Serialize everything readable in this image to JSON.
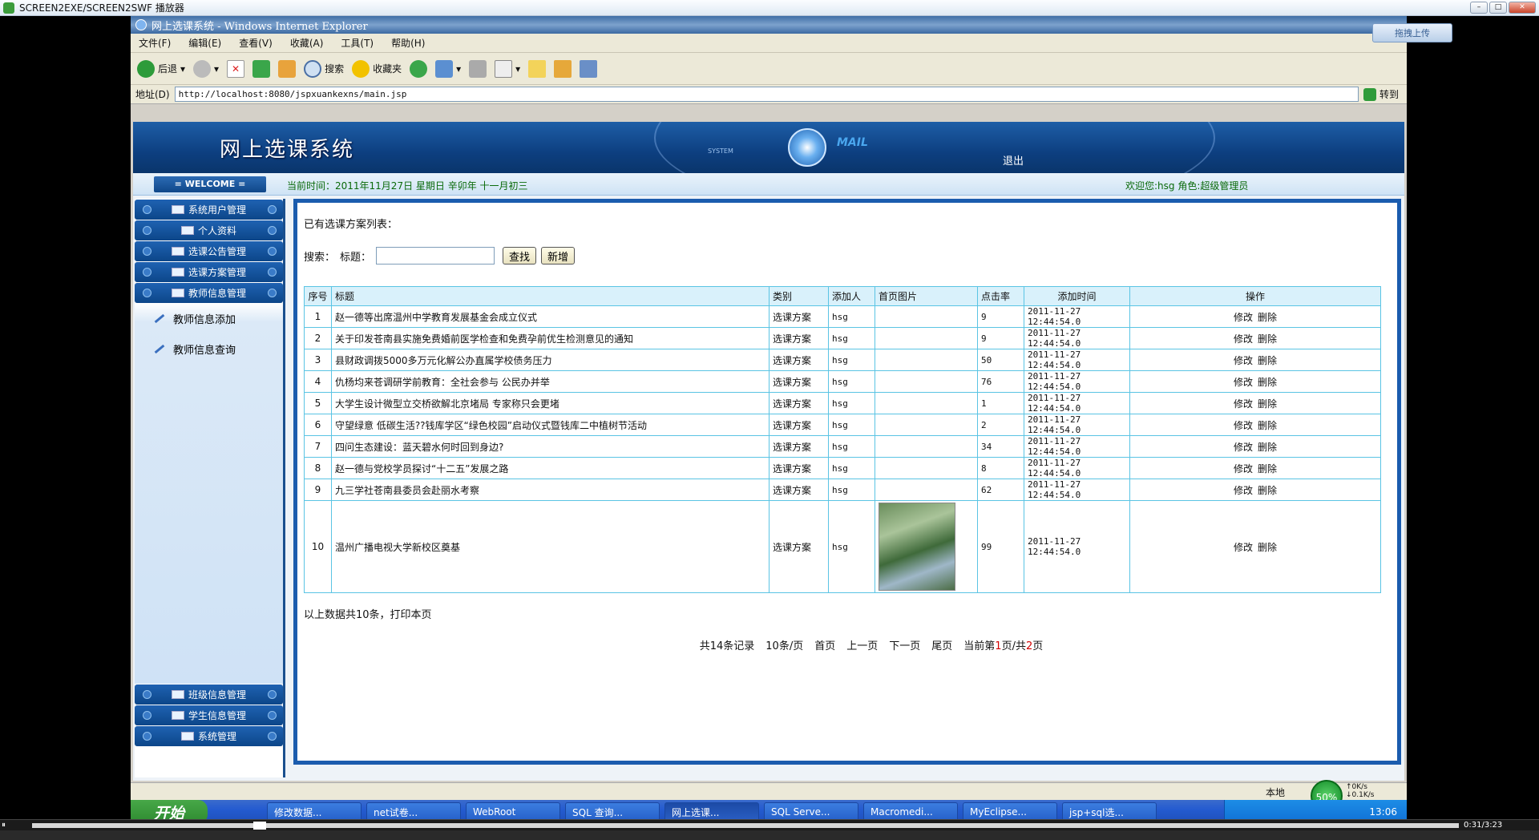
{
  "player": {
    "title": "SCREEN2EXE/SCREEN2SWF 播放器",
    "time": "0:31/3:23"
  },
  "browser": {
    "title": "网上选课系统 - Windows Internet Explorer",
    "upload_label": "拖拽上传",
    "menu": [
      "文件(F)",
      "编辑(E)",
      "查看(V)",
      "收藏(A)",
      "工具(T)",
      "帮助(H)"
    ],
    "toolbar": {
      "back": "后退",
      "search": "搜索",
      "favorites": "收藏夹"
    },
    "address_label": "地址(D)",
    "url": "http://localhost:8080/jspxuankexns/main.jsp",
    "go": "转到"
  },
  "header": {
    "title": "网上选课系统",
    "system_text": "SYSTEM",
    "mail_text": "MAIL",
    "logout": "退出",
    "welcome": "= WELCOME =",
    "current_time": "当前时间：2011年11月27日 星期日 辛卯年 十一月初三",
    "user_info": "欢迎您:hsg 角色:超级管理员"
  },
  "sidebar": {
    "items": [
      "系统用户管理",
      "个人资料",
      "选课公告管理",
      "选课方案管理",
      "教师信息管理"
    ],
    "subitems": [
      "教师信息添加",
      "教师信息查询"
    ],
    "lower_items": [
      "班级信息管理",
      "学生信息管理",
      "系统管理"
    ]
  },
  "main": {
    "list_title": "已有选课方案列表：",
    "search_label": "搜索：",
    "title_label": "标题：",
    "search_btn": "查找",
    "add_btn": "新增",
    "columns": [
      "序号",
      "标题",
      "类别",
      "添加人",
      "首页图片",
      "点击率",
      "添加时间",
      "操作"
    ],
    "rows": [
      {
        "no": "1",
        "title": "赵一德等出席温州中学教育发展基金会成立仪式",
        "category": "选课方案",
        "adder": "hsg",
        "clicks": "9",
        "time": "2011-11-27 12:44:54.0"
      },
      {
        "no": "2",
        "title": "关于印发苍南县实施免费婚前医学检查和免费孕前优生检测意见的通知",
        "category": "选课方案",
        "adder": "hsg",
        "clicks": "9",
        "time": "2011-11-27 12:44:54.0"
      },
      {
        "no": "3",
        "title": "县财政调拨5000多万元化解公办直属学校债务压力",
        "category": "选课方案",
        "adder": "hsg",
        "clicks": "50",
        "time": "2011-11-27 12:44:54.0"
      },
      {
        "no": "4",
        "title": "仇杨均来苍调研学前教育：全社会参与 公民办并举",
        "category": "选课方案",
        "adder": "hsg",
        "clicks": "76",
        "time": "2011-11-27 12:44:54.0"
      },
      {
        "no": "5",
        "title": "大学生设计微型立交桥欲解北京堵局 专家称只会更堵",
        "category": "选课方案",
        "adder": "hsg",
        "clicks": "1",
        "time": "2011-11-27 12:44:54.0"
      },
      {
        "no": "6",
        "title": "守望绿意 低碳生活??钱库学区“绿色校园”启动仪式暨钱库二中植树节活动",
        "category": "选课方案",
        "adder": "hsg",
        "clicks": "2",
        "time": "2011-11-27 12:44:54.0"
      },
      {
        "no": "7",
        "title": "四问生态建设：蓝天碧水何时回到身边?",
        "category": "选课方案",
        "adder": "hsg",
        "clicks": "34",
        "time": "2011-11-27 12:44:54.0"
      },
      {
        "no": "8",
        "title": "赵一德与党校学员探讨“十二五”发展之路",
        "category": "选课方案",
        "adder": "hsg",
        "clicks": "8",
        "time": "2011-11-27 12:44:54.0"
      },
      {
        "no": "9",
        "title": "九三学社苍南县委员会赴丽水考察",
        "category": "选课方案",
        "adder": "hsg",
        "clicks": "62",
        "time": "2011-11-27 12:44:54.0"
      },
      {
        "no": "10",
        "title": "温州广播电视大学新校区奠基",
        "category": "选课方案",
        "adder": "hsg",
        "clicks": "99",
        "time": "2011-11-27 12:44:54.0"
      }
    ],
    "edit": "修改",
    "delete": "删除",
    "summary": "以上数据共10条，打印本页",
    "pager": {
      "total": "共14条记录",
      "per_page": "10条/页",
      "first": "首页",
      "prev": "上一页",
      "next": "下一页",
      "last": "尾页",
      "current_a": "当前第",
      "current_page": "1",
      "current_b": "页/共",
      "total_pages": "2",
      "current_c": "页"
    }
  },
  "status": {
    "zone": "本地",
    "zoom": "50%",
    "up": "0K/s",
    "down": "0.1K/s"
  },
  "taskbar": {
    "start": "开始",
    "tasks": [
      "修改数据...",
      "net试卷...",
      "WebRoot",
      "SQL 查询...",
      "网上选课...",
      "SQL Serve...",
      "Macromedi...",
      "MyEclipse...",
      "jsp+sql选..."
    ],
    "clock": "13:06"
  }
}
